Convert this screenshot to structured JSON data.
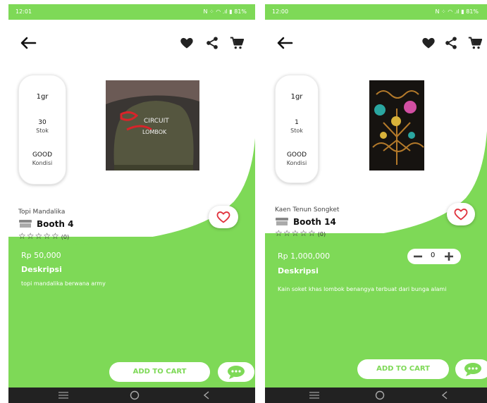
{
  "screens": [
    {
      "status_time": "12:01",
      "status_icons": "N ⁘ ◠ .ıl ▮ 81%",
      "stats": {
        "weight": "1gr",
        "stock_value": "30",
        "stock_label": "Stok",
        "condition_value": "GOOD",
        "condition_label": "Kondisi"
      },
      "image_text": [
        "CIRCUIT",
        "LOMBOK"
      ],
      "product_name": "Topi Mandalika",
      "booth": "Booth 4",
      "stars": "☆☆☆☆☆",
      "rating_count": "(0)",
      "price": "Rp 50,000",
      "desc_title": "Deskripsi",
      "description": "topi mandalika berwana army",
      "cart_label": "ADD TO CART"
    },
    {
      "status_time": "12:00",
      "status_icons": "N ⁘ ◠ .ıl ▮ 81%",
      "stats": {
        "weight": "1gr",
        "stock_value": "1",
        "stock_label": "Stok",
        "condition_value": "GOOD",
        "condition_label": "Kondisi"
      },
      "product_name": "Kaen Tenun Songket",
      "booth": "Booth 14",
      "stars": "☆☆☆☆☆",
      "rating_count": "(0)",
      "price": "Rp 1,000,000",
      "quantity": "0",
      "desc_title": "Deskripsi",
      "description": "Kain soket khas lombok benangya terbuat dari bunga alami",
      "cart_label": "ADD TO CART"
    }
  ],
  "colors": {
    "accent": "#7ed957",
    "heart": "#e0313c",
    "navbar": "#222222"
  },
  "icons": [
    "back-arrow-icon",
    "heart-icon",
    "share-icon",
    "cart-icon",
    "store-icon",
    "heart-outline-icon",
    "chat-icon",
    "minus-icon",
    "plus-icon"
  ]
}
